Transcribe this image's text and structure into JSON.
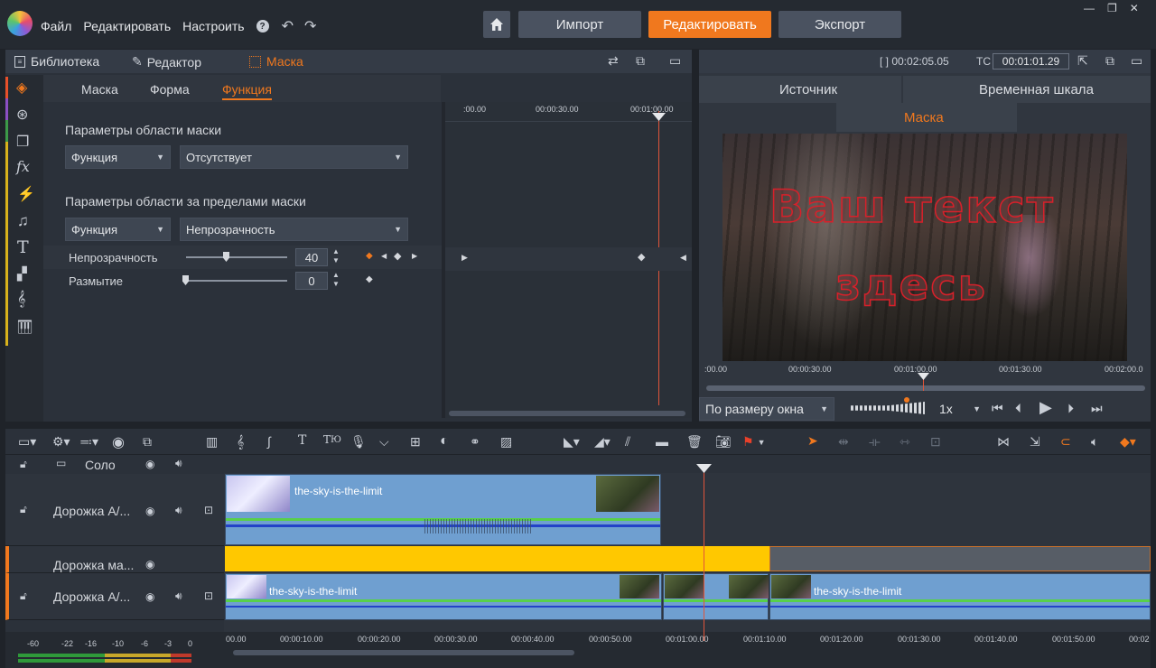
{
  "app": {
    "menu": [
      "Файл",
      "Редактировать",
      "Настроить"
    ],
    "help_icon": "help-icon",
    "undo_icon": "undo-icon",
    "redo_icon": "redo-icon",
    "nav": {
      "import": "Импорт",
      "edit": "Редактировать",
      "export": "Экспорт"
    },
    "accent": "#f0781e"
  },
  "left_panel": {
    "tabs": [
      "Библиотека",
      "Редактор",
      "Маска"
    ],
    "subtabs": [
      "Маска",
      "Форма",
      "Функция"
    ],
    "section1": {
      "title": "Параметры области маски",
      "combo1": "Функция",
      "combo2": "Отсутствует"
    },
    "section2": {
      "title": "Параметры области за пределами маски",
      "combo1": "Функция",
      "combo2": "Непрозрачность"
    },
    "params": [
      {
        "label": "Непрозрачность",
        "value": "40",
        "level": 0.4
      },
      {
        "label": "Размытие",
        "value": "0",
        "level": 0
      }
    ],
    "keyframe_ruler": [
      ":00.00",
      "00:00:30.00",
      "00:01:00.00"
    ]
  },
  "preview": {
    "tc_in_label": "[ ] 00:02:05.05",
    "tc_label": "TC",
    "tc_value": "00:01:01.29",
    "tabs": [
      "Источник",
      "Временная шкала"
    ],
    "subtab": "Маска",
    "overlay_text": [
      "Ваш текст",
      "здесь"
    ],
    "ruler": [
      ":00.00",
      "00:00:30.00",
      "00:01:00.00",
      "00:01:30.00",
      "00:02:00.0"
    ],
    "fit_label": "По размеру окна",
    "speed": "1x"
  },
  "timeline": {
    "solo": "Соло",
    "tracks": [
      {
        "name": "Дорожка А/..."
      },
      {
        "name": "Дорожка ма..."
      },
      {
        "name": "Дорожка А/..."
      }
    ],
    "clip_title": "the-sky-is-the-limit",
    "ruler": [
      "00.00",
      "00:00:10.00",
      "00:00:20.00",
      "00:00:30.00",
      "00:00:40.00",
      "00:00:50.00",
      "00:01:00.00",
      "00:01:10.00",
      "00:01:20.00",
      "00:01:30.00",
      "00:01:40.00",
      "00:01:50.00",
      "00:02"
    ],
    "meter_labels": [
      "-60",
      "-22",
      "-16",
      "-10",
      "-6",
      "-3",
      "0"
    ]
  }
}
